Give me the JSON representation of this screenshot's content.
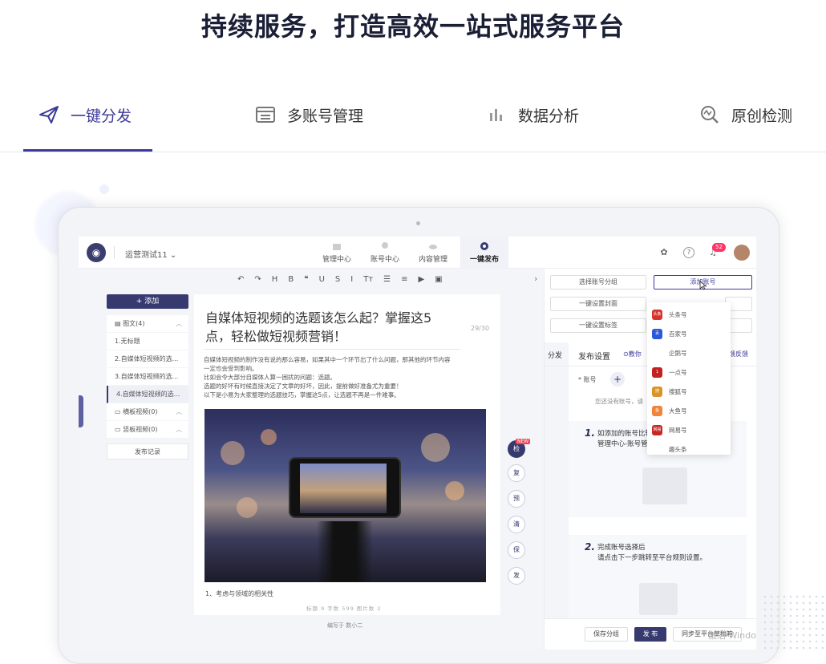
{
  "hero_title": "持续服务，打造高效一站式服务平台",
  "feature_tabs": [
    {
      "label": "一键分发",
      "icon": "paper-plane-icon",
      "active": true
    },
    {
      "label": "多账号管理",
      "icon": "account-panel-icon",
      "active": false
    },
    {
      "label": "数据分析",
      "icon": "bar-chart-icon",
      "active": false
    },
    {
      "label": "原创检测",
      "icon": "detect-magnifier-icon",
      "active": false
    }
  ],
  "accent_color": "#3b3a9a",
  "app": {
    "org_name": "运营测试11 ⌄",
    "nav": [
      {
        "label": "管理中心"
      },
      {
        "label": "账号中心"
      },
      {
        "label": "内容管理"
      },
      {
        "label": "一键发布",
        "active": true
      }
    ],
    "notification_count": "52",
    "toolbar_icons": [
      "undo-icon",
      "redo-icon",
      "heading-icon",
      "bold-icon",
      "quote-icon",
      "underline-icon",
      "strikethrough-icon",
      "italic-icon",
      "text-size-icon",
      "bullet-list-icon",
      "align-icon",
      "video-icon",
      "image-icon"
    ],
    "toolbar_glyphs": [
      "↶",
      "↷",
      "H",
      "B",
      "❝",
      "U",
      "S",
      "I",
      "Tт",
      "☰",
      "≡",
      "▶",
      "▣"
    ],
    "left_panel": {
      "add_label": "+ 添加",
      "groups": [
        {
          "label": "图文(4)",
          "chev": "︿"
        },
        {
          "label": "横板视频(0)",
          "chev": "︿"
        },
        {
          "label": "竖板视频(0)",
          "chev": "︿"
        }
      ],
      "items": [
        "1.无标题",
        "2.自媒体短视频的选...",
        "3.自媒体短视频的选...",
        "4.自媒体短视频的选..."
      ],
      "record_label": "发布记录"
    },
    "editor": {
      "title": "自媒体短视频的选题该怎么起？掌握这5点，轻松做短视频营销！",
      "char_count": "29/30",
      "body_lines": [
        "自媒体短视频的制作没有说的那么容易，如果其中一个环节出了什么问题，那其他的环节内容",
        "一定也会受到影响。",
        "比如会令大部分自媒体人算一困扰的问题：选题。",
        "选题的好坏有时候直接决定了文章的好坏，因此，提前做好准备尤为重要！",
        "以下是小易为大家整理的选题技巧，掌握这5点，让选题不再是一件难事。"
      ],
      "caption": "1、考虑与领域的相关性",
      "stats": "标题 9  字数 599  图片数 2",
      "footer": "编写于  数小二"
    },
    "side_actions": [
      "检",
      "复",
      "预",
      "清",
      "保",
      "发"
    ],
    "new_tag": "NEW",
    "right_panel": {
      "btn_group": "选择账号分组",
      "btn_add": "添加账号",
      "btn_cover": "一键设置封面",
      "btn_tag": "一键设置标签",
      "tab_fenfa": "分发",
      "tab_settings": "发布设置",
      "tab_tutorial": "教你",
      "tab_feedback": "馈反馈",
      "account_label": "* 账号",
      "no_account": "您还没有账号，请",
      "tip1_num": "1.",
      "tip1_line1": "如添加的账号比较多，可使用批量导入功能",
      "tip1_line2": "管理中心-账号管理-批量导入账号。",
      "tip2_num": "2.",
      "tip2_line1": "完成账号选择后",
      "tip2_line2": "请点击下一步跳转至平台规则设置。",
      "platforms": [
        {
          "name": "头条号",
          "color": "#d6342c",
          "glyph": "头条"
        },
        {
          "name": "百家号",
          "color": "#2b57d9",
          "glyph": "百"
        },
        {
          "name": "企鹅号",
          "color": "#ffffff",
          "glyph": ""
        },
        {
          "name": "一点号",
          "color": "#c4201f",
          "glyph": "1"
        },
        {
          "name": "搜狐号",
          "color": "#d9942a",
          "glyph": "搜"
        },
        {
          "name": "大鱼号",
          "color": "#f0843a",
          "glyph": "鱼"
        },
        {
          "name": "网易号",
          "color": "#c42a22",
          "glyph": "网易"
        },
        {
          "name": "趣头条",
          "color": "#ffffff",
          "glyph": ""
        }
      ],
      "footer_save": "保存分组",
      "footer_publish": "发 布",
      "footer_sync": "同步至平台草稿箱"
    }
  },
  "watermark": "激活 Windo"
}
